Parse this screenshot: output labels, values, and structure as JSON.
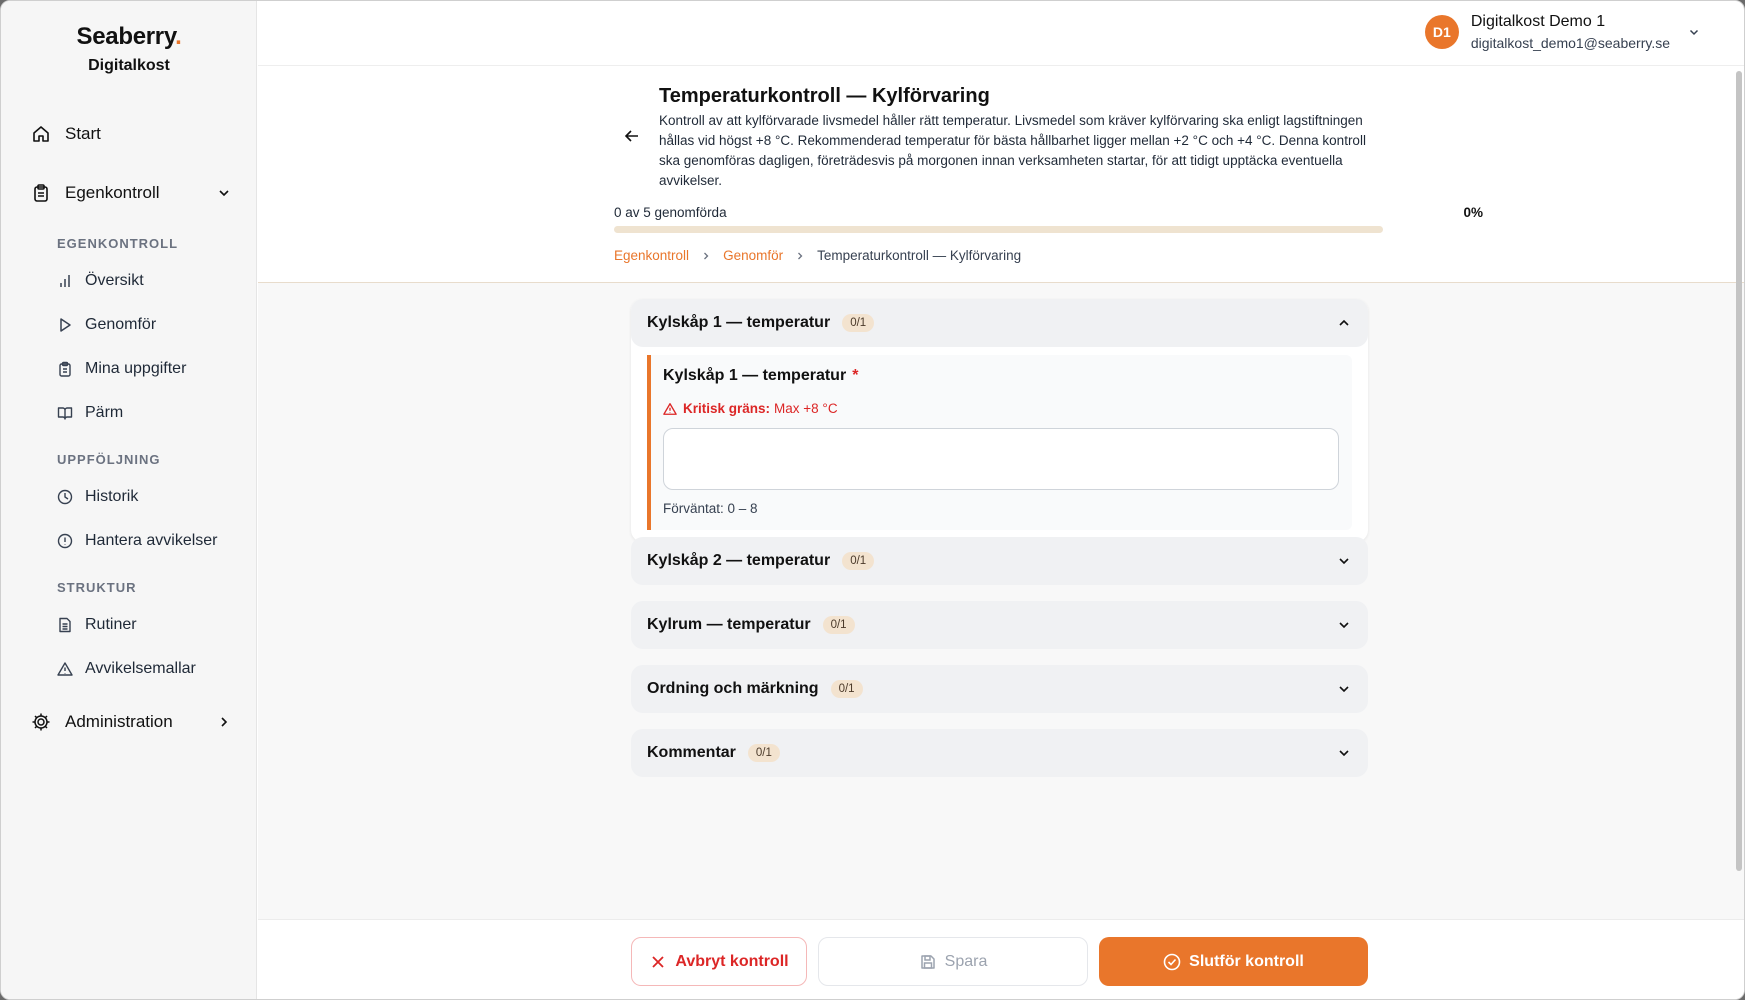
{
  "brand": {
    "name": "Seaberry",
    "dot": ".",
    "sub": "Digitalkost"
  },
  "nav": {
    "start": "Start",
    "egenkontroll": "Egenkontroll",
    "section_egenkontroll": "EGENKONTROLL",
    "oversikt": "Översikt",
    "genomfor": "Genomför",
    "mina_uppgifter": "Mina uppgifter",
    "parm": "Pärm",
    "section_uppfoljning": "UPPFÖLJNING",
    "historik": "Historik",
    "hantera_avvikelser": "Hantera avvikelser",
    "section_struktur": "STRUKTUR",
    "rutiner": "Rutiner",
    "avvikelsemallar": "Avvikelsemallar",
    "administration": "Administration"
  },
  "user": {
    "initials": "D1",
    "name": "Digitalkost Demo 1",
    "email": "digitalkost_demo1@seaberry.se"
  },
  "header": {
    "title": "Temperaturkontroll — Kylförvaring",
    "description": "Kontroll av att kylförvarade livsmedel håller rätt temperatur. Livsmedel som kräver kylförvaring ska enligt lagstiftningen hållas vid högst +8 °C. Rekommenderad temperatur för bästa hållbarhet ligger mellan +2 °C och +4 °C. Denna kontroll ska genomföras dagligen, företrädesvis på morgonen innan verksamheten startar, för att tidigt upptäcka eventuella avvikelser.",
    "progress_label": "0 av 5 genomförda",
    "progress_pct": "0%",
    "progress_value": 0
  },
  "breadcrumb": {
    "item1": "Egenkontroll",
    "item2": "Genomför",
    "current": "Temperaturkontroll — Kylförvaring"
  },
  "sections": [
    {
      "title": "Kylskåp 1 — temperatur",
      "badge": "0/1",
      "expanded": true,
      "item": {
        "title": "Kylskåp 1 — temperatur",
        "required": "*",
        "critical_label": "Kritisk gräns:",
        "critical_value": "Max +8 °C",
        "input_value": "",
        "expected": "Förväntat: 0 – 8"
      }
    },
    {
      "title": "Kylskåp 2 — temperatur",
      "badge": "0/1",
      "expanded": false
    },
    {
      "title": "Kylrum — temperatur",
      "badge": "0/1",
      "expanded": false
    },
    {
      "title": "Ordning och märkning",
      "badge": "0/1",
      "expanded": false
    },
    {
      "title": "Kommentar",
      "badge": "0/1",
      "expanded": false
    }
  ],
  "footer": {
    "cancel": "Avbryt kontroll",
    "save": "Spara",
    "finish": "Slutför kontroll"
  },
  "colors": {
    "accent": "#e9762b",
    "danger": "#dc2626"
  }
}
